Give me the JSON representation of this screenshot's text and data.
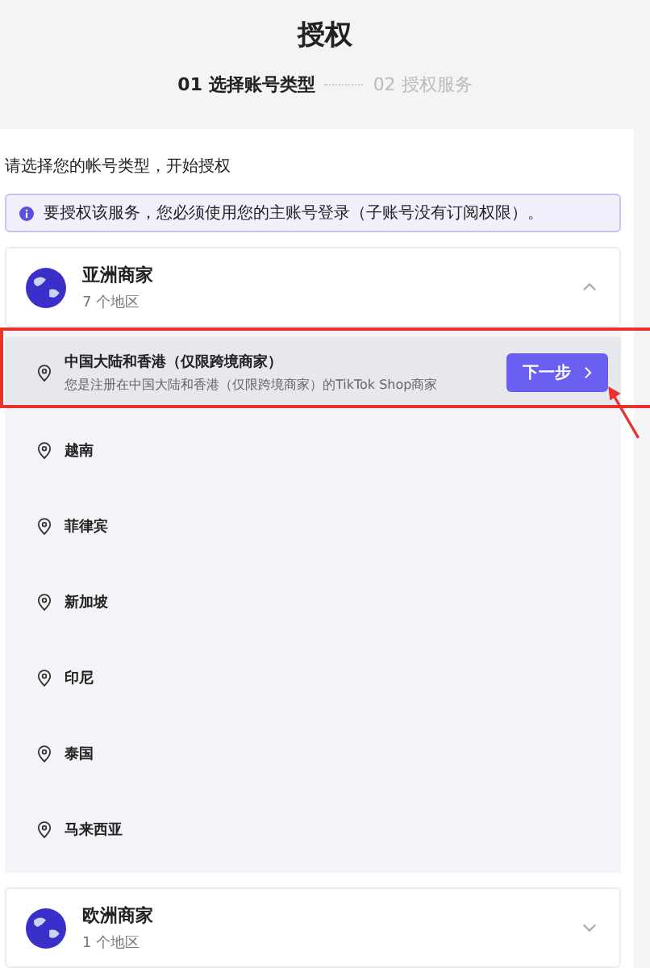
{
  "title": "授权",
  "steps": [
    {
      "label": "01 选择账号类型",
      "selected": true
    },
    {
      "label": "02 授权服务",
      "selected": false
    }
  ],
  "intro": "请选择您的帐号类型，开始授权",
  "notice": "要授权该服务，您必须使用您的主账号登录（子账号没有订阅权限）。",
  "groups": [
    {
      "name": "亚洲商家",
      "count": "7 个地区",
      "expanded": true,
      "regions": [
        {
          "name": "中国大陆和香港（仅限跨境商家）",
          "description": "您是注册在中国大陆和香港（仅限跨境商家）的TikTok Shop商家",
          "selected": true,
          "button": "下一步"
        },
        {
          "name": "越南",
          "selected": false
        },
        {
          "name": "菲律宾",
          "selected": false
        },
        {
          "name": "新加坡",
          "selected": false
        },
        {
          "name": "印尼",
          "selected": false
        },
        {
          "name": "泰国",
          "selected": false
        },
        {
          "name": "马来西亚",
          "selected": false
        }
      ]
    },
    {
      "name": "欧洲商家",
      "count": "1 个地区",
      "expanded": false
    }
  ]
}
